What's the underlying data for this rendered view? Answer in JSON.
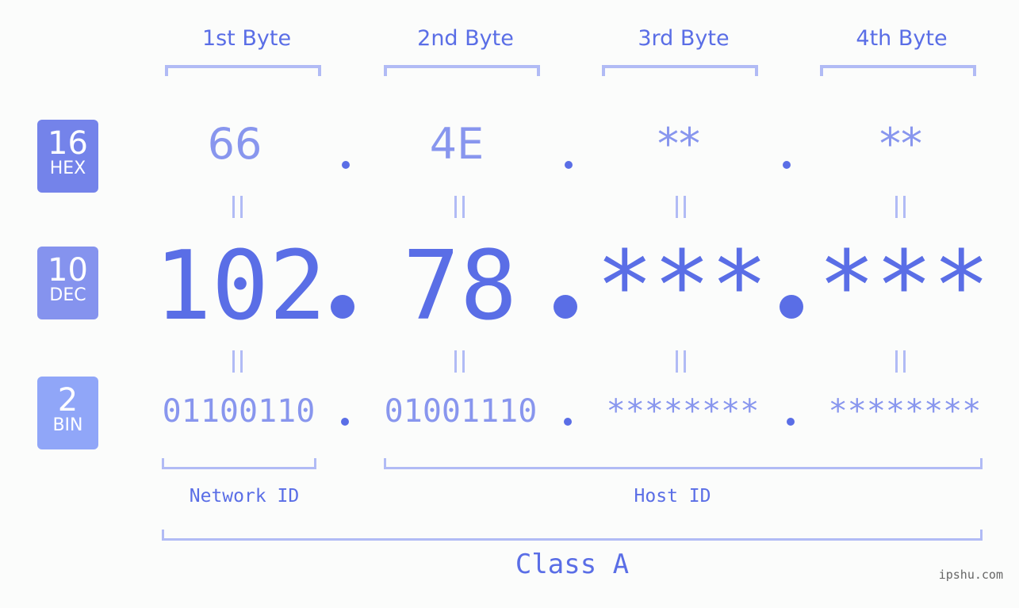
{
  "bytes": [
    {
      "title": "1st Byte",
      "hex": "66",
      "dec": "102",
      "bin": "01100110"
    },
    {
      "title": "2nd Byte",
      "hex": "4E",
      "dec": "78",
      "bin": "01001110"
    },
    {
      "title": "3rd Byte",
      "hex": "**",
      "dec": "***",
      "bin": "********"
    },
    {
      "title": "4th Byte",
      "hex": "**",
      "dec": "***",
      "bin": "********"
    }
  ],
  "bases": {
    "hex": {
      "num": "16",
      "label": "HEX",
      "color": "#7483ea"
    },
    "dec": {
      "num": "10",
      "label": "DEC",
      "color": "#8593ee"
    },
    "bin": {
      "num": "2",
      "label": "BIN",
      "color": "#90a6f8"
    }
  },
  "labels": {
    "network_id": "Network ID",
    "host_id": "Host ID",
    "class": "Class A"
  },
  "watermark": "ipshu.com",
  "colors": {
    "accent": "#5a6ee6",
    "light_accent": "#8896ee",
    "bracket": "#b1bbf5"
  }
}
